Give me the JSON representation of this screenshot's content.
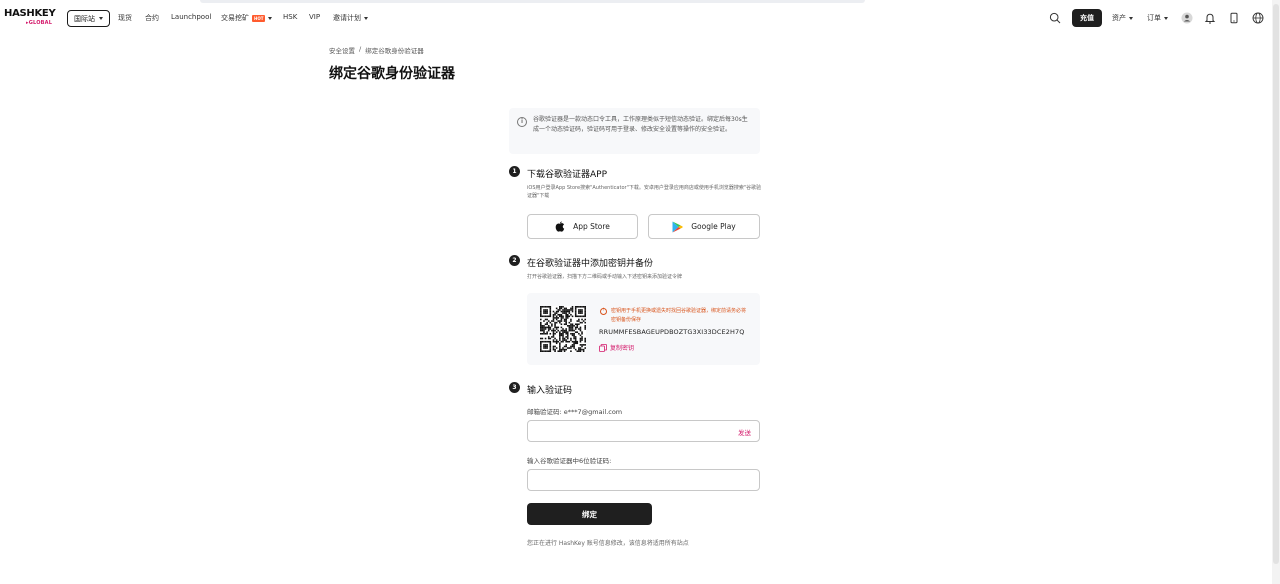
{
  "header": {
    "logo_main": "HASHKEY",
    "logo_sub": "▸GLOBAL",
    "region": "国际站",
    "nav": [
      {
        "label": "现货"
      },
      {
        "label": "合约"
      },
      {
        "label": "Launchpool"
      },
      {
        "label": "交易挖矿",
        "badge": "HOT"
      },
      {
        "label": "HSK"
      },
      {
        "label": "VIP"
      },
      {
        "label": "邀请计划"
      }
    ],
    "deposit": "充值",
    "assets": "资产",
    "orders": "订单",
    "icons": [
      "search-icon",
      "user-icon",
      "bell-icon",
      "phone-icon",
      "globe-icon"
    ]
  },
  "breadcrumb": {
    "parent": "安全设置",
    "separator": "/",
    "current": "绑定谷歌身份验证器"
  },
  "page_title": "绑定谷歌身份验证器",
  "info": "谷歌验证器是一款动态口令工具，工作原理类似于短信动态验证。绑定后每30s生成一个动态验证码，验证码可用于登录、修改安全设置等操作的安全验证。",
  "steps": [
    {
      "num": "1",
      "title": "下载谷歌验证器APP",
      "desc": "iOS用户登录App Store搜索\"Authenticator\"下载。安卓用户登录应用商店或使用手机浏览器搜索\"谷歌验证器\"下载",
      "app_store": "App Store",
      "google_play": "Google Play"
    },
    {
      "num": "2",
      "title": "在谷歌验证器中添加密钥并备份",
      "desc": "打开谷歌验证器，扫描下方二维码或手动输入下述密钥来添加验证令牌",
      "warning": "密钥用于手机更换或遗失时找回谷歌验证器，绑定前请务必将密钥备份保存",
      "secret": "RRUMMFESBAGEUPDBOZTG3XI33DCE2H7Q",
      "copy_label": "复制密钥"
    },
    {
      "num": "3",
      "title": "输入验证码",
      "email_label": "邮箱验证码: e***7@gmail.com",
      "send_label": "发送",
      "ga_label": "输入谷歌验证器中6位验证码:"
    }
  ],
  "bind_button": "绑定",
  "footnote": "您正在进行 HashKey 账号信息修改，该信息将适用所有站点"
}
